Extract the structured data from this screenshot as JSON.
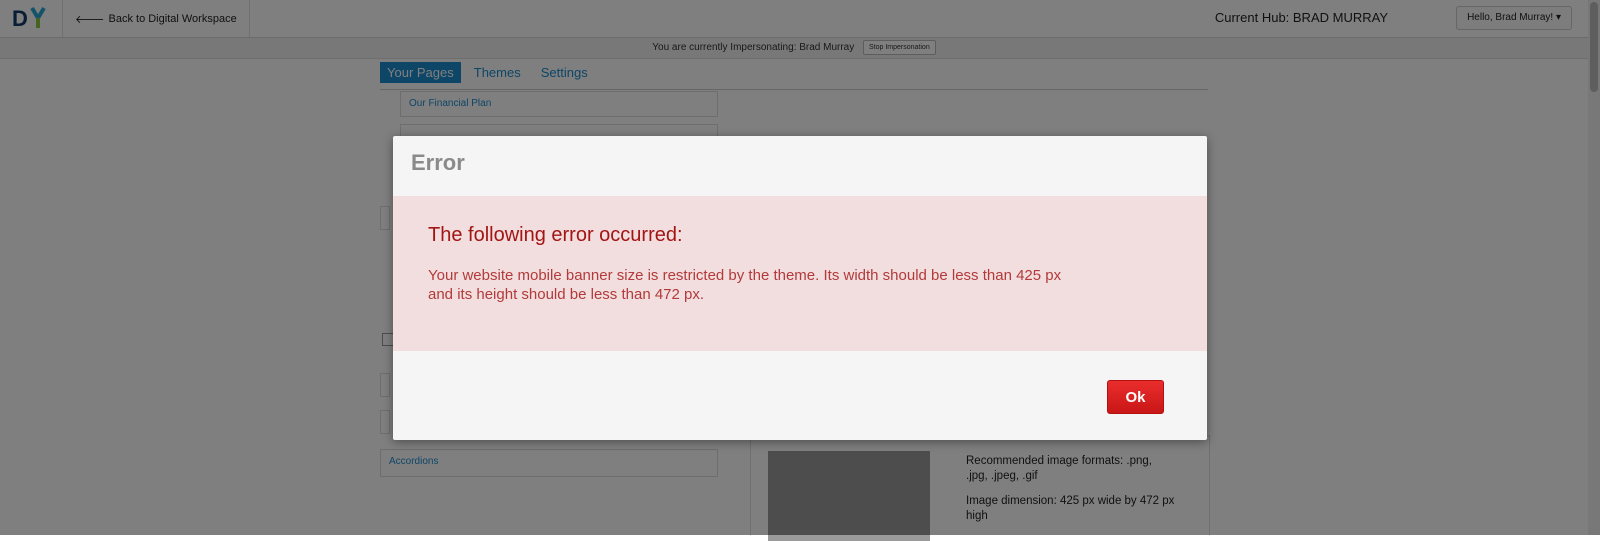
{
  "topbar": {
    "back_label": "Back to Digital Workspace",
    "hub_label": "Current Hub: BRAD MURRAY",
    "user_menu_label": "Hello, Brad Murray! ▾"
  },
  "impersonation": {
    "text": "You are currently Impersonating: Brad Murray",
    "stop_label": "Stop Impersonation"
  },
  "tabs": [
    {
      "label": "Your Pages",
      "active": true
    },
    {
      "label": "Themes",
      "active": false
    },
    {
      "label": "Settings",
      "active": false
    }
  ],
  "pages": {
    "financial_plan": "Our Financial Plan",
    "accordions": "Accordions"
  },
  "image_info": {
    "formats": "Recommended image formats: .png, .jpg, .jpeg, .gif",
    "dimension": "Image dimension: 425 px wide by 472 px high"
  },
  "modal": {
    "title": "Error",
    "heading": "The following error occurred:",
    "message": "Your website mobile banner size is restricted by the theme. Its width should be less than 425 px and its height should be less than 472 px.",
    "ok_label": "Ok"
  },
  "colors": {
    "accent": "#1a8ccf",
    "error_bg": "#f2dede",
    "error_text": "#a31515",
    "ok_button": "#d91f1f"
  }
}
